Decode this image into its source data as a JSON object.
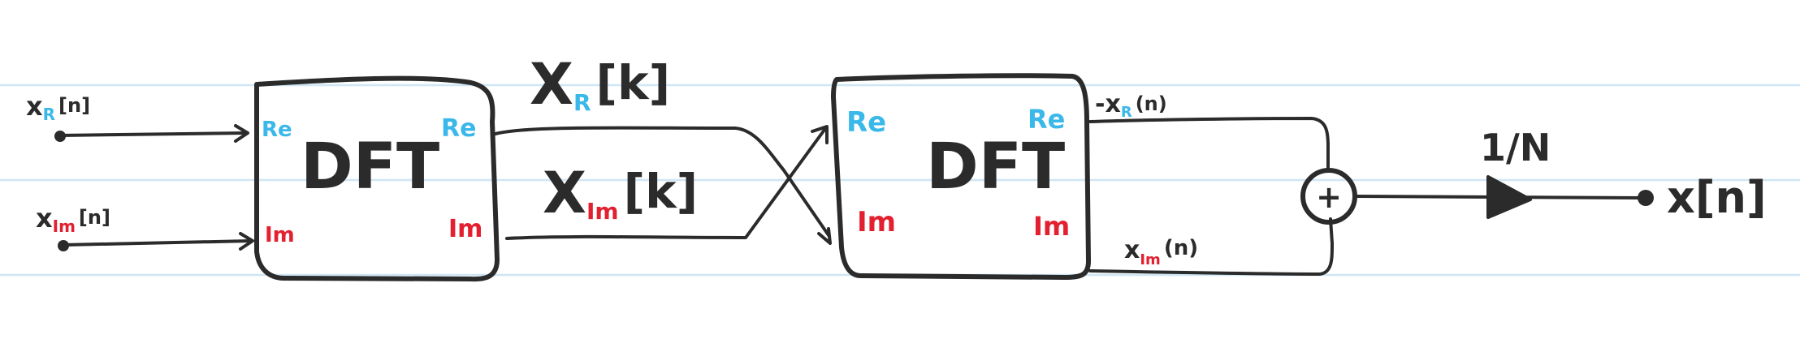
{
  "colors": {
    "ink": "#2b2b2b",
    "real": "#3ab8ea",
    "imag": "#e3202f",
    "ruled_line": "#cfe6f5"
  },
  "inputs": {
    "real": {
      "base": "x",
      "sub": "R",
      "arg": "[n]"
    },
    "imag": {
      "base": "x",
      "sub": "Im",
      "arg": "[n]"
    }
  },
  "dft1": {
    "title": "DFT",
    "port_re_in": "Re",
    "port_im_in": "Im",
    "port_re_out": "Re",
    "port_im_out": "Im"
  },
  "mid_signals": {
    "real": {
      "base": "X",
      "sub": "R",
      "arg": "[k]"
    },
    "imag": {
      "base": "X",
      "sub": "Im",
      "arg": "[k]"
    }
  },
  "dft2": {
    "title": "DFT",
    "port_re_in": "Re",
    "port_im_in": "Im",
    "port_re_out": "Re",
    "port_im_out": "Im"
  },
  "outputs_mid": {
    "real": {
      "base": "-x",
      "sub": "R",
      "arg": "(n)"
    },
    "imag": {
      "base": "x",
      "sub": "Im",
      "arg": "(n)"
    }
  },
  "adder": {
    "symbol": "+"
  },
  "gain": {
    "label": "1/N"
  },
  "output": {
    "label": "x[n]"
  }
}
